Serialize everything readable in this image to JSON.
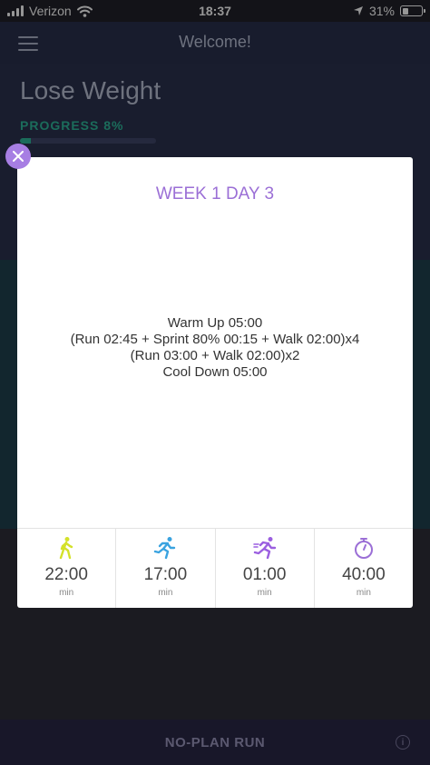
{
  "status_bar": {
    "carrier": "Verizon",
    "time": "18:37",
    "battery": "31%",
    "battery_level": 0.31
  },
  "app": {
    "header_title": "Welcome!",
    "goal_title": "Lose Weight",
    "progress_label": "PROGRESS 8%",
    "progress_value": 0.08,
    "bottom_button": "NO-PLAN RUN"
  },
  "modal": {
    "title": "WEEK 1 DAY 3",
    "workout_lines": [
      "Warm Up 05:00",
      "(Run 02:45 + Sprint 80% 00:15 + Walk 02:00)x4",
      "(Run 03:00 + Walk 02:00)x2",
      "Cool Down 05:00"
    ],
    "stats": [
      {
        "icon": "walk-icon",
        "value": "22:00",
        "unit": "min",
        "color": "#d4e12a"
      },
      {
        "icon": "run-icon",
        "value": "17:00",
        "unit": "min",
        "color": "#3aa3e0"
      },
      {
        "icon": "sprint-icon",
        "value": "01:00",
        "unit": "min",
        "color": "#9b5fe0"
      },
      {
        "icon": "stopwatch-icon",
        "value": "40:00",
        "unit": "min",
        "color": "#9b6fd6"
      }
    ]
  },
  "colors": {
    "accent": "#a77ee3",
    "progress": "#2aa68c"
  }
}
